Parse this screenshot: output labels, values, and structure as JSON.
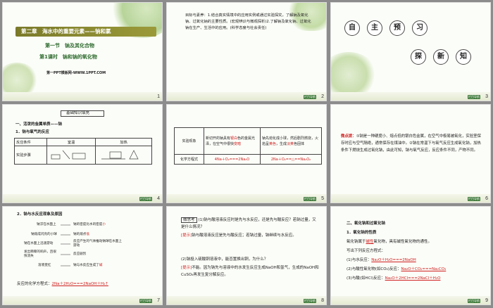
{
  "slides": [
    {
      "number": "1",
      "chapter": "第二章　海水中的重要元素——钠和氯",
      "section": "第一节　钠及其化合物",
      "lesson": "第1课时　钠和钠的氧化物",
      "brand": "第一PPT模板网-WWW.1PPT.COM"
    },
    {
      "number": "2",
      "body": "目标与素养：1.结合真实情境中的应用实例或通过实验探究，了解钠及氧化钠、过氧化钠的主要性质。(宏观辨识与微观探析)2.了解钠及氧化钠、过氧化钠在生产、生活中的应用。(科学态度与社会责任)",
      "back": "栏目导航"
    },
    {
      "number": "3",
      "chars": [
        "自",
        "主",
        "预",
        "习"
      ],
      "chars2": [
        "探",
        "新",
        "知"
      ],
      "back": "栏目导航"
    },
    {
      "number": "4",
      "title": "基础知识填充",
      "h1": "一、活泼的金属单质——钠",
      "h2": "1．钠与氧气的反应",
      "col1": "反应条件",
      "col2": "室温",
      "col3": "加热",
      "row2": "实验步骤",
      "back": "栏目导航"
    },
    {
      "number": "5",
      "r1c1": "实验现象",
      "r1c2a": "新切开的钠具有",
      "r1c2b": "银白",
      "r1c2c": "色的金属光泽，在空气中很快",
      "r1c2d": "变暗",
      "r1c3a": "钠先熔化成小球，然后剧烈燃烧，火焰呈",
      "r1c3b": "黄色",
      "r1c3c": "，生成",
      "r1c3d": "淡黄",
      "r1c3e": "色固体",
      "r2c1": "化学方程式",
      "r2c2": "4Na＋O₂===2Na₂O",
      "r2c3": "2Na＋O₂==△==Na₂O₂",
      "back": "栏目导航"
    },
    {
      "number": "6",
      "label": "微点拨：",
      "body": "①钠是一种硬度小、熔点低的银白色金属，在空气中极易被氧化，实验室保存时应与空气隔绝，通常保存在煤油中。②钠在常温下与氧气反应生成氧化钠，加热条件下燃烧生成过氧化钠，由此可知，钠与氧气反应，反应条件不同，产物不同。",
      "back": "栏目导航"
    },
    {
      "number": "7",
      "title": "2．钠与水反应现象及原因",
      "rows": [
        "钠浮在水面上",
        "钠熔成闪亮的小球",
        "钠在水面上迅速游动",
        "发出嘶嘶的响声，且很快消失",
        "溶液变红"
      ],
      "reasons": [
        "钠的密度比水的密度",
        "小",
        "钠的熔点",
        "低",
        "反应产生的气体推动钠球在水面上游动",
        "反应剧烈",
        "钠与水反应生成了",
        "碱"
      ],
      "formula_label": "反应的化学方程式：",
      "formula": "2Na＋2H₂O===2NaOH＋H₂↑",
      "back": "栏目导航"
    },
    {
      "number": "8",
      "q_label": "微思考",
      "q1": "(1)钠与酸溶液反应时是先与水反应，还是先与酸反应？若钠过量，又是什么情况？",
      "a1_label": "[提示]",
      "a1": "钠与酸溶液反应是先与酸反应；若钠过量，钠继续与水反应。",
      "q2": "(2)钠投入硫酸铜溶液中，能否置换出铜，为什么？",
      "a2_label": "[提示]",
      "a2": "不能。因为钠先与溶液中的水发生反应生成NaOH和氢气，生成的NaOH和CuSO₄再发生复分解反应。",
      "back": "栏目导航"
    },
    {
      "number": "9",
      "h1": "二、氧化钠和过氧化钠",
      "h2": "1．氧化钠的性质",
      "l1a": "氧化钠属于",
      "l1b": "碱性",
      "l1c": "氧化物，具有碱性氧化物的通性。",
      "l2": "写出下列反应方程式：",
      "e1": "(1)与水反应：",
      "e1f": "Na₂O＋H₂O===2NaOH",
      "e2": "(2)与酸性氧化物(如CO₂)反应：",
      "e2f": "Na₂O＋CO₂===Na₂CO₃",
      "e3": "(3)与酸(如HCl)反应：",
      "e3f": "Na₂O＋2HCl===2NaCl＋H₂O",
      "back": "栏目导航"
    }
  ]
}
